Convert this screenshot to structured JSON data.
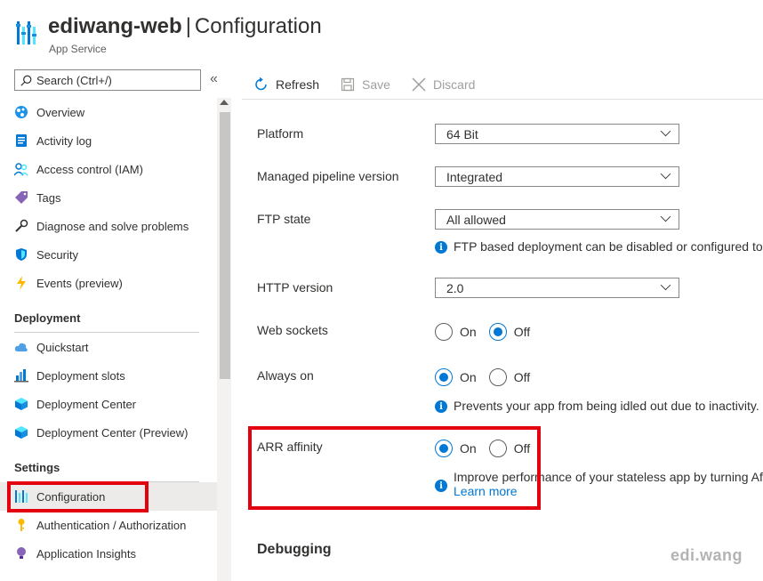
{
  "header": {
    "resource_name": "ediwang-web",
    "separator": "|",
    "blade_title": "Configuration",
    "subtitle": "App Service"
  },
  "search": {
    "placeholder": "Search (Ctrl+/)"
  },
  "collapse_icon": "«",
  "sidebar": {
    "top_items": [
      {
        "label": "Overview",
        "icon": "overview-icon"
      },
      {
        "label": "Activity log",
        "icon": "activity-log-icon"
      },
      {
        "label": "Access control (IAM)",
        "icon": "iam-icon"
      },
      {
        "label": "Tags",
        "icon": "tag-icon"
      },
      {
        "label": "Diagnose and solve problems",
        "icon": "wrench-icon"
      },
      {
        "label": "Security",
        "icon": "shield-icon"
      },
      {
        "label": "Events (preview)",
        "icon": "lightning-icon"
      }
    ],
    "deployment_label": "Deployment",
    "deployment_items": [
      {
        "label": "Quickstart",
        "icon": "cloud-icon"
      },
      {
        "label": "Deployment slots",
        "icon": "chart-icon"
      },
      {
        "label": "Deployment Center",
        "icon": "cube-icon"
      },
      {
        "label": "Deployment Center (Preview)",
        "icon": "cube-icon"
      }
    ],
    "settings_label": "Settings",
    "settings_items": [
      {
        "label": "Configuration",
        "icon": "configuration-icon",
        "active": true
      },
      {
        "label": "Authentication / Authorization",
        "icon": "key-icon"
      },
      {
        "label": "Application Insights",
        "icon": "lightbulb-icon"
      }
    ]
  },
  "toolbar": {
    "refresh": "Refresh",
    "save": "Save",
    "discard": "Discard"
  },
  "settings": {
    "platform": {
      "label": "Platform",
      "value": "64 Bit"
    },
    "pipeline": {
      "label": "Managed pipeline version",
      "value": "Integrated"
    },
    "ftp": {
      "label": "FTP state",
      "value": "All allowed",
      "info": "FTP based deployment can be disabled or configured to"
    },
    "http": {
      "label": "HTTP version",
      "value": "2.0"
    },
    "websockets": {
      "label": "Web sockets",
      "on": "On",
      "off": "Off",
      "selected": "Off"
    },
    "always_on": {
      "label": "Always on",
      "on": "On",
      "off": "Off",
      "selected": "On",
      "info": "Prevents your app from being idled out due to inactivity."
    },
    "arr": {
      "label": "ARR affinity",
      "on": "On",
      "off": "Off",
      "selected": "On",
      "info": "Improve performance of your stateless app by turning Af",
      "link": "Learn more"
    }
  },
  "debugging_title": "Debugging",
  "watermark": "edi.wang",
  "colors": {
    "accent": "#0078d4",
    "highlight": "#e3000f"
  }
}
